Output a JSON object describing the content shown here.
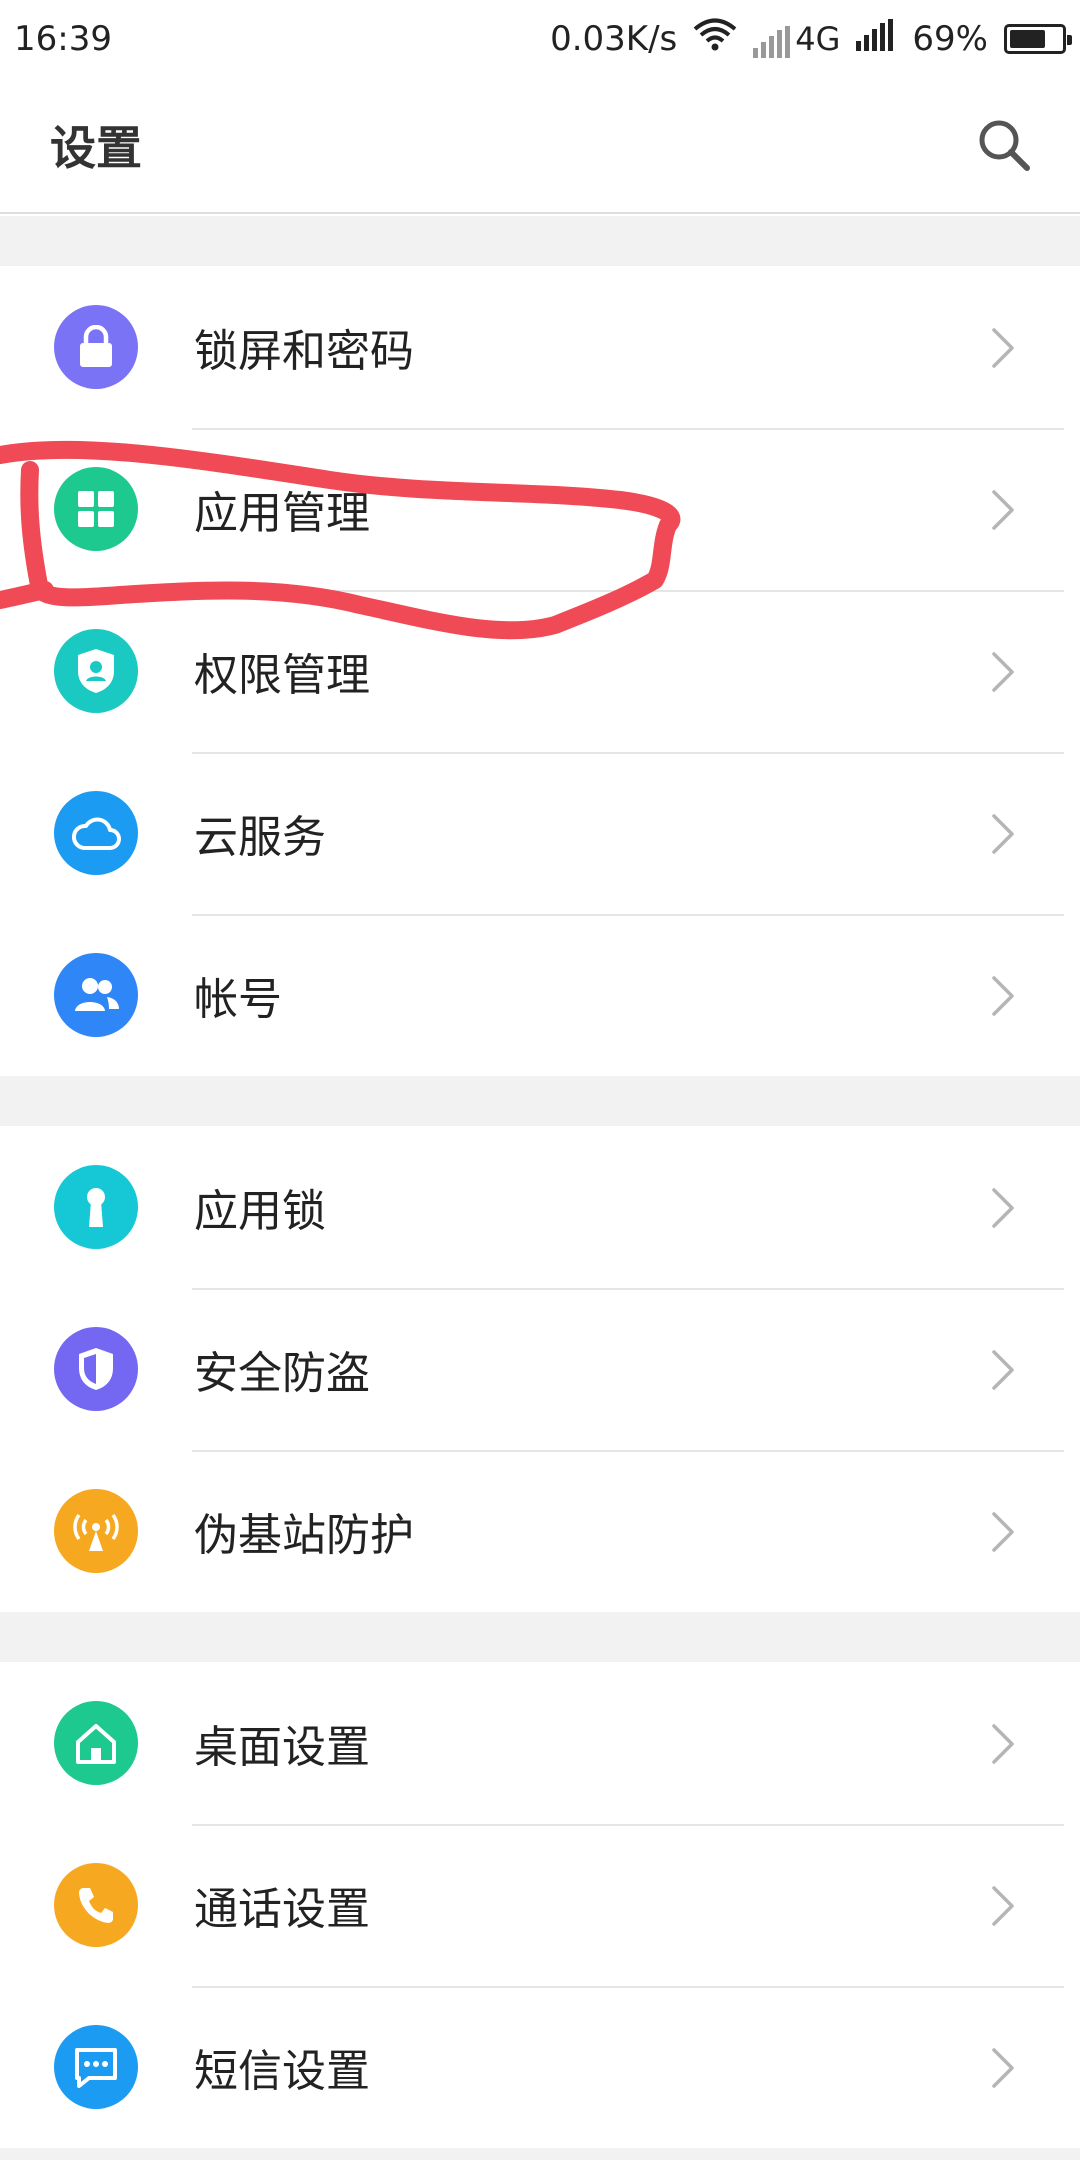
{
  "status": {
    "time": "16:39",
    "net_speed": "0.03K/s",
    "network": "4G",
    "battery": "69%",
    "battery_level": 0.69
  },
  "header": {
    "title": "设置"
  },
  "groups": [
    {
      "items": [
        {
          "label": "锁屏和密码",
          "icon": "lock-icon",
          "color": "#7b73f6"
        },
        {
          "label": "应用管理",
          "icon": "apps-grid-icon",
          "color": "#1ec98f"
        },
        {
          "label": "权限管理",
          "icon": "permission-shield-icon",
          "color": "#19c9c2"
        },
        {
          "label": "云服务",
          "icon": "cloud-icon",
          "color": "#1b9cf2"
        },
        {
          "label": "帐号",
          "icon": "account-icon",
          "color": "#2f86f6"
        }
      ]
    },
    {
      "items": [
        {
          "label": "应用锁",
          "icon": "keyhole-icon",
          "color": "#16c8d6"
        },
        {
          "label": "安全防盗",
          "icon": "shield-icon",
          "color": "#7468f3"
        },
        {
          "label": "伪基站防护",
          "icon": "signal-tower-icon",
          "color": "#f6a820"
        }
      ]
    },
    {
      "items": [
        {
          "label": "桌面设置",
          "icon": "home-icon",
          "color": "#1ec98f"
        },
        {
          "label": "通话设置",
          "icon": "phone-icon",
          "color": "#f6a820"
        },
        {
          "label": "短信设置",
          "icon": "message-icon",
          "color": "#1b9cf2"
        }
      ]
    }
  ]
}
